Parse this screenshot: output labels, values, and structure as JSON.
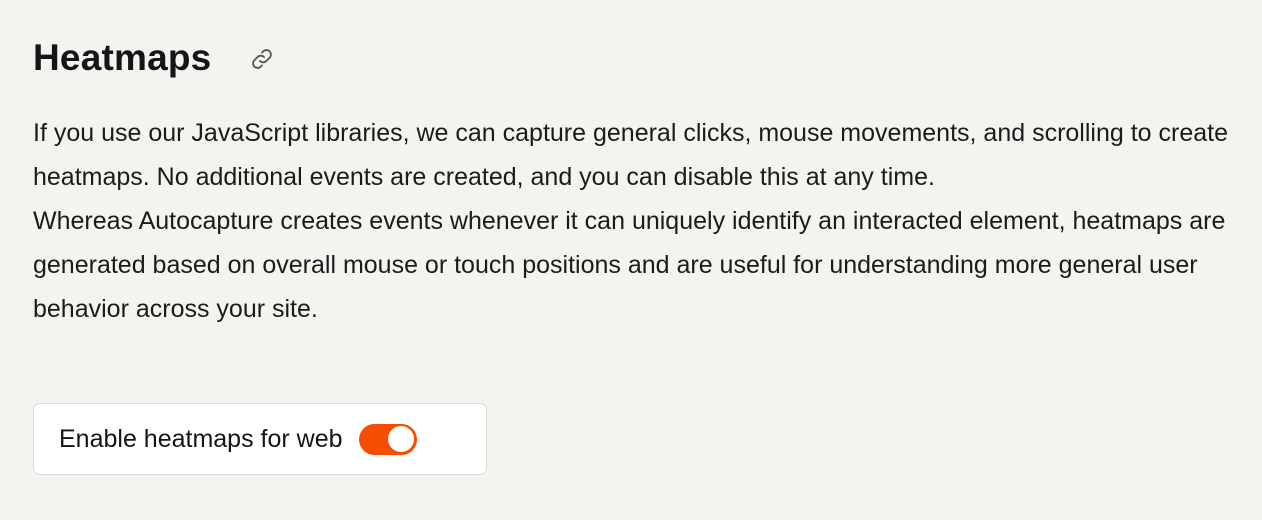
{
  "section": {
    "title": "Heatmaps",
    "link_icon": "link-icon",
    "paragraph_1": "If you use our JavaScript libraries, we can capture general clicks, mouse movements, and scrolling to create heatmaps. No additional events are created, and you can disable this at any time.",
    "paragraph_2": "Whereas Autocapture creates events whenever it can uniquely identify an interacted element, heatmaps are generated based on overall mouse or touch positions and are useful for understanding more general user behavior across your site."
  },
  "toggle": {
    "label": "Enable heatmaps for web",
    "checked": true,
    "accent_color": "#f54e00"
  }
}
